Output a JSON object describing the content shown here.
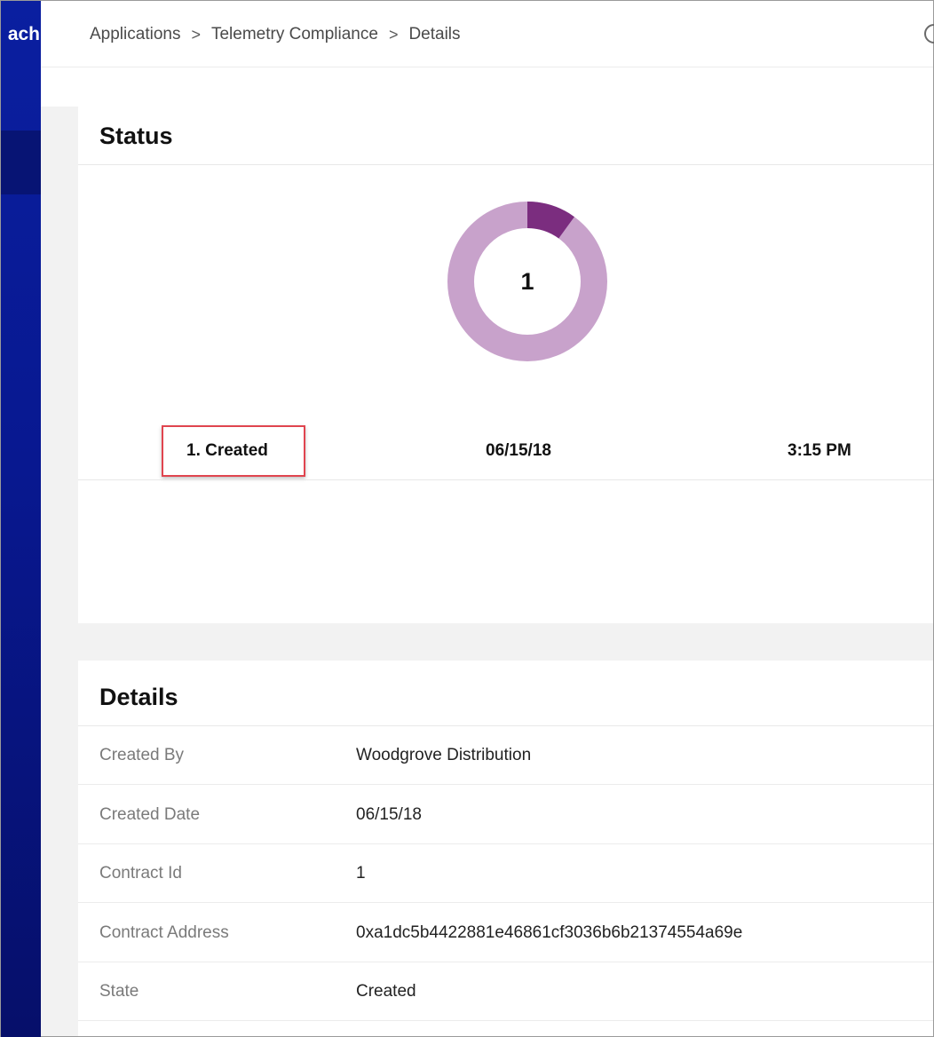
{
  "app": {
    "brand_fragment": "ach"
  },
  "breadcrumb": {
    "items": [
      "Applications",
      "Telemetry Compliance",
      "Details"
    ],
    "separator": ">"
  },
  "status": {
    "title": "Status",
    "donut": {
      "center_label": "1",
      "segments": [
        {
          "name": "Created",
          "fraction": 0.1,
          "color": "#7b2d7f"
        },
        {
          "name": "remaining",
          "fraction": 0.9,
          "color": "#c8a2cb"
        }
      ]
    },
    "current_state": {
      "label": "1. Created",
      "date": "06/15/18",
      "time": "3:15 PM"
    }
  },
  "details": {
    "title": "Details",
    "rows": [
      {
        "label": "Created By",
        "value": "Woodgrove Distribution"
      },
      {
        "label": "Created Date",
        "value": "06/15/18"
      },
      {
        "label": "Contract Id",
        "value": "1"
      },
      {
        "label": "Contract Address",
        "value": "0xa1dc5b4422881e46861cf3036b6b21374554a69e"
      },
      {
        "label": "State",
        "value": "Created"
      }
    ]
  },
  "colors": {
    "nav_bg": "#081890",
    "accent_dark": "#7b2d7f",
    "accent_light": "#c8a2cb",
    "highlight_box": "#e0454f"
  }
}
